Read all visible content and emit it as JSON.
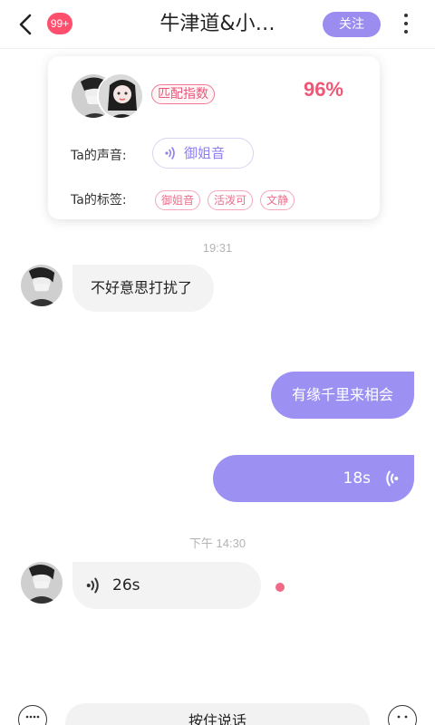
{
  "header": {
    "unread_badge": "99+",
    "title": "牛津道&小…",
    "follow_label": "关注"
  },
  "card": {
    "match_label": "匹配指数",
    "match_value": "96%",
    "voice_label": "Ta的声音:",
    "voice_type": "御姐音",
    "tags_label": "Ta的标签:",
    "tags": [
      "御姐音",
      "活泼可",
      "文静"
    ]
  },
  "chat": {
    "time1": "19:31",
    "msg1": "不好意思打扰了",
    "msg2": "有缘千里来相会",
    "voice_out_duration": "18s",
    "time2": "下午 14:30",
    "voice_in_duration": "26s"
  },
  "bottom": {
    "hold_to_talk": "按住说话"
  },
  "colors": {
    "accent": "#9c90f3",
    "badge": "#ff4f6d",
    "match": "#ef5777"
  }
}
